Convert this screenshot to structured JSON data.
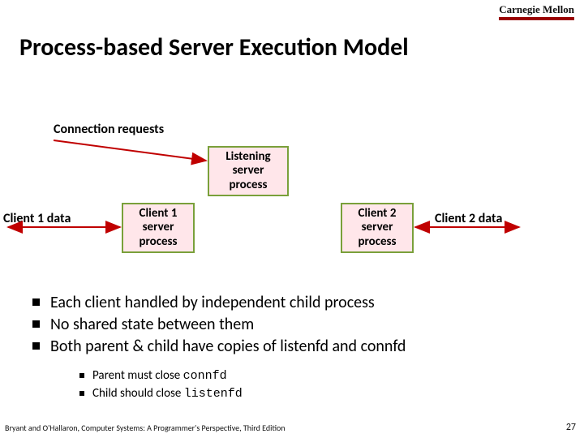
{
  "brand": "Carnegie Mellon",
  "title": "Process-based Server Execution Model",
  "diagram": {
    "connection_requests": "Connection requests",
    "listening": "Listening\nserver\nprocess",
    "client1_process": "Client 1\nserver\nprocess",
    "client2_process": "Client 2\nserver\nprocess",
    "client1_data": "Client 1 data",
    "client2_data": "Client 2 data"
  },
  "bullets": {
    "first": [
      "Each client handled by independent child process",
      "No shared state between them",
      "Both parent & child have copies of listenfd and connfd"
    ],
    "second_pre": [
      "Parent must close ",
      "Child should close "
    ],
    "second_code": [
      "connfd",
      "listenfd"
    ]
  },
  "footer": "Bryant and O'Hallaron, Computer Systems: A Programmer's Perspective, Third Edition",
  "page": "27"
}
